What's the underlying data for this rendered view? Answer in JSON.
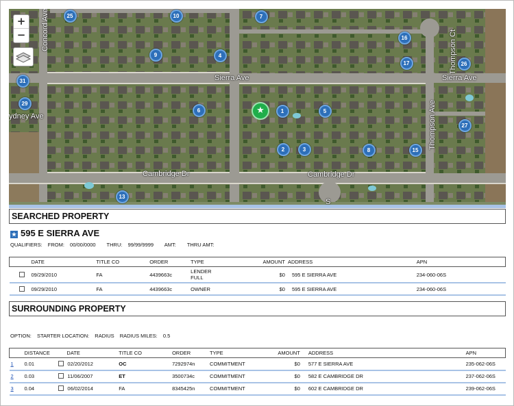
{
  "map": {
    "zoom_in": "+",
    "zoom_out": "−",
    "layers_icon": "layers-icon",
    "streets": {
      "concord_ave": "Concord Ave",
      "sierra_ave_left": "Sierra Ave",
      "sierra_ave_right": "Sierra Ave",
      "sydney_ave": "ydney Ave",
      "cambridge_left": "Cambridge Dr",
      "cambridge_right": "Cambridge Dr",
      "thompson_ct": "Thompson Ct",
      "thompson_ave": "Thompson Ave",
      "s_label": "S"
    },
    "markers": [
      "25",
      "10",
      "7",
      "16",
      "9",
      "4",
      "17",
      "26",
      "31",
      "29",
      "6",
      "1",
      "5",
      "27",
      "2",
      "3",
      "8",
      "15",
      "13"
    ],
    "star": "★"
  },
  "searched": {
    "section_title": "SEARCHED PROPERTY",
    "property_name": "595 E SIERRA AVE",
    "qualifiers": {
      "label": "QUALIFIERS:",
      "from_label": "FROM:",
      "from_value": "00/00/0000",
      "thru_label": "THRU:",
      "thru_value": "99/99/9999",
      "amt_label": "AMT:",
      "thru_amt_label": "THRU AMT:"
    },
    "columns": {
      "date": "DATE",
      "title_co": "TITLE CO",
      "order": "ORDER",
      "type": "TYPE",
      "amount": "AMOUNT",
      "address": "ADDRESS",
      "apn": "APN"
    },
    "rows": [
      {
        "date": "09/29/2010",
        "title_co": "FA",
        "order": "4439663c",
        "type_line1": "LENDER",
        "type_line2": "FULL",
        "amount": "$0",
        "address": "595 E SIERRA AVE",
        "apn": "234-060-06S"
      },
      {
        "date": "09/29/2010",
        "title_co": "FA",
        "order": "4439663c",
        "type_line1": "OWNER",
        "type_line2": "",
        "amount": "$0",
        "address": "595 E SIERRA AVE",
        "apn": "234-060-06S"
      }
    ]
  },
  "surrounding": {
    "section_title": "SURROUNDING PROPERTY",
    "option": {
      "label": "OPTION:",
      "starter_label": "STARTER LOCATION:",
      "starter_value": "RADIUS",
      "radius_label": "RADIUS MILES:",
      "radius_value": "0.5"
    },
    "columns": {
      "index": "",
      "distance": "DISTANCE",
      "date": "DATE",
      "title_co": "TITLE CO",
      "order": "ORDER",
      "type": "TYPE",
      "amount": "AMOUNT",
      "address": "ADDRESS",
      "apn": "APN"
    },
    "rows": [
      {
        "index": "1",
        "distance": "0.01",
        "date": "02/20/2012",
        "title_co": "OC",
        "order": "7292974n",
        "type": "COMMITMENT",
        "amount": "$0",
        "address": "577 E SIERRA AVE",
        "apn": "235-062-06S"
      },
      {
        "index": "2",
        "distance": "0.03",
        "date": "11/06/2007",
        "title_co": "ET",
        "order": "3500734c",
        "type": "COMMITMENT",
        "amount": "$0",
        "address": "582 E CAMBRIDGE DR",
        "apn": "237-062-06S"
      },
      {
        "index": "3",
        "distance": "0.04",
        "date": "06/02/2014",
        "title_co": "FA",
        "order": "8345425n",
        "type": "COMMITMENT",
        "amount": "$0",
        "address": "602 E CAMBRIDGE DR",
        "apn": "239-062-06S"
      }
    ]
  },
  "colors": {
    "marker_blue": "#2d6fb9",
    "star_green": "#1fae4a",
    "row_divider": "#a8c3e6",
    "link": "#1a4fb3"
  }
}
